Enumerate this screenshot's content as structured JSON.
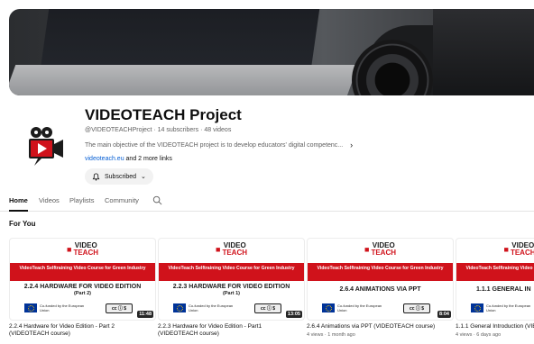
{
  "channel": {
    "name": "VIDEOTEACH Project",
    "handle_stats": "@VIDEOTEACHProject · 14 subscribers · 48 videos",
    "description": "The main objective of the VIDEOTEACH project is to develop educators' digital competenc...",
    "link": "videoteach.eu",
    "more_links": " and 2 more links",
    "subscribe_label": "Subscribed"
  },
  "tabs": [
    {
      "label": "Home"
    },
    {
      "label": "Videos"
    },
    {
      "label": "Playlists"
    },
    {
      "label": "Community"
    }
  ],
  "section_title": "For You",
  "thumbnail_common": {
    "logo_top": "VIDEO",
    "logo_bottom": "TEACH",
    "band": "VideoTeach Selftraining Video Course for Green Industry",
    "eu_text": "Co-funded by the European Union",
    "cc": "cc ⓘ $"
  },
  "videos": [
    {
      "heading": "2.2.4 HARDWARE FOR VIDEO EDITION",
      "sub": "(Part 2)",
      "duration": "11:48",
      "title": "2.2.4 Hardware for Video Edition - Part 2 (VIDEOTEACH course)",
      "meta": ""
    },
    {
      "heading": "2.2.3 HARDWARE FOR VIDEO EDITION",
      "sub": "(Part 1)",
      "duration": "13:05",
      "title": "2.2.3 Hardware for Video Edition - Part1 (VIDEOTEACH course)",
      "meta": ""
    },
    {
      "heading": "2.6.4 ANIMATIONS VIA PPT",
      "sub": "",
      "duration": "8:04",
      "title": "2.6.4 Animations via PPT (VIDEOTEACH course)",
      "meta": "4 views · 1 month ago"
    },
    {
      "heading": "1.1.1 GENERAL IN",
      "sub": "",
      "duration": "",
      "title": "1.1.1 General Introduction (VIE",
      "meta": "4 views · 6 days ago"
    }
  ],
  "colors": {
    "accent": "#d0121b",
    "link": "#065fd4",
    "eu_blue": "#003399"
  }
}
